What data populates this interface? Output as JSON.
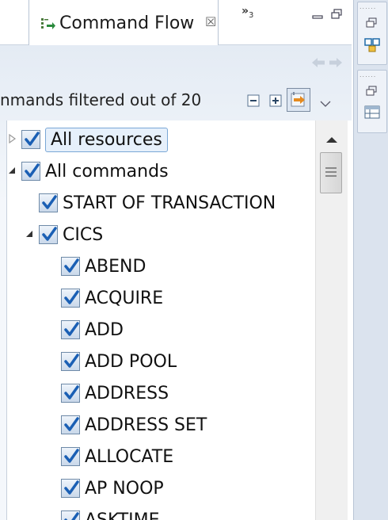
{
  "tab": {
    "title": "Command Flow",
    "close_symbol": "☒",
    "overflow_label": "»",
    "overflow_count": "3"
  },
  "toolbar": {
    "status_text": "nmands filtered out of 20"
  },
  "icons": {
    "tab": "command-flow-view-icon",
    "back": "back-arrow-icon",
    "forward": "forward-arrow-icon",
    "collapse": "collapse-all-icon",
    "expand": "expand-all-icon",
    "filter": "filter-toggle-icon",
    "menu": "view-menu-chevron-icon"
  },
  "colors": {
    "check": "#1a5fb4",
    "panel_bg": "#e4ebf4",
    "selection_border": "#7aa7d6"
  },
  "tree": {
    "nodes": [
      {
        "label": "All resources",
        "level": 0,
        "checked": true,
        "twisty": "collapsed",
        "selected": true
      },
      {
        "label": "All commands",
        "level": 0,
        "checked": true,
        "twisty": "expanded",
        "selected": false
      },
      {
        "label": "START OF TRANSACTION",
        "level": 1,
        "checked": true,
        "twisty": "none",
        "selected": false
      },
      {
        "label": "CICS",
        "level": 1,
        "checked": true,
        "twisty": "expanded",
        "selected": false
      },
      {
        "label": "ABEND",
        "level": 2,
        "checked": true,
        "twisty": "none",
        "selected": false
      },
      {
        "label": "ACQUIRE",
        "level": 2,
        "checked": true,
        "twisty": "none",
        "selected": false
      },
      {
        "label": "ADD",
        "level": 2,
        "checked": true,
        "twisty": "none",
        "selected": false
      },
      {
        "label": "ADD POOL",
        "level": 2,
        "checked": true,
        "twisty": "none",
        "selected": false
      },
      {
        "label": "ADDRESS",
        "level": 2,
        "checked": true,
        "twisty": "none",
        "selected": false
      },
      {
        "label": "ADDRESS SET",
        "level": 2,
        "checked": true,
        "twisty": "none",
        "selected": false
      },
      {
        "label": "ALLOCATE",
        "level": 2,
        "checked": true,
        "twisty": "none",
        "selected": false
      },
      {
        "label": "AP NOOP",
        "level": 2,
        "checked": true,
        "twisty": "none",
        "selected": false
      },
      {
        "label": "ASKTIME",
        "level": 2,
        "checked": true,
        "twisty": "none",
        "selected": false
      }
    ]
  },
  "side_panel": {
    "icons": [
      "maximize-icon",
      "outline-view-icon",
      "maximize-icon",
      "table-view-icon"
    ]
  }
}
